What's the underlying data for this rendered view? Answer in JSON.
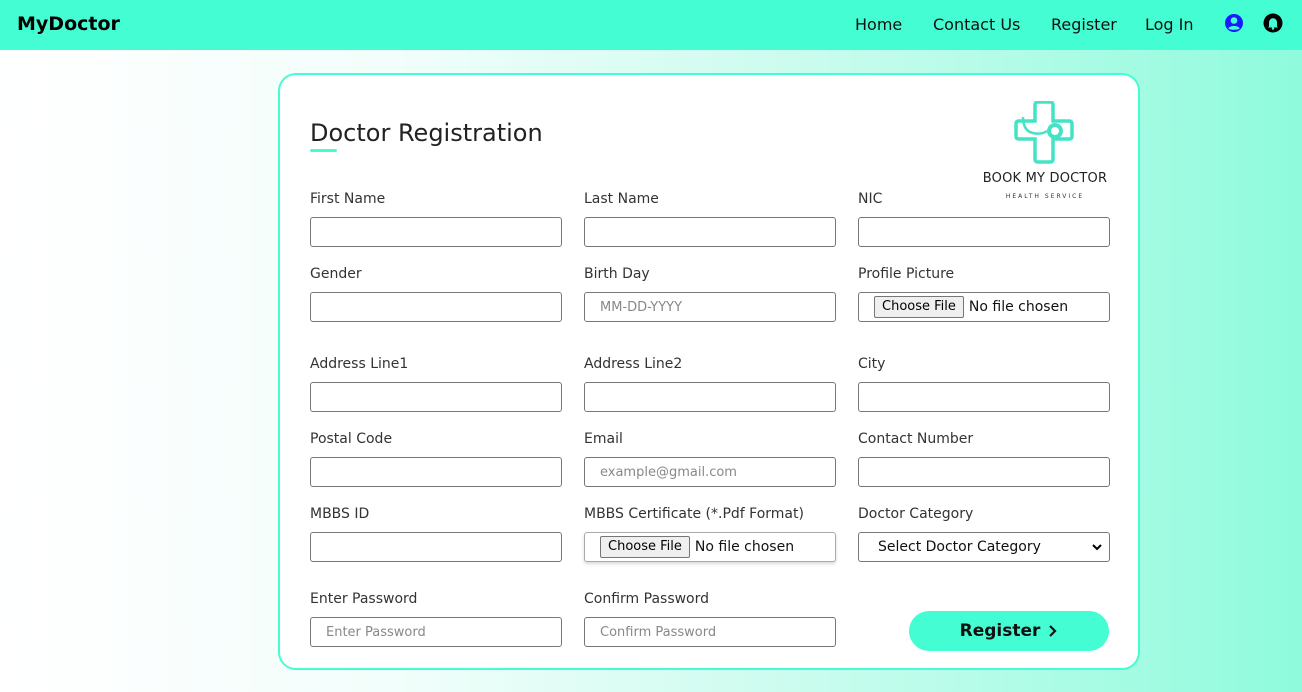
{
  "nav": {
    "brand": "MyDoctor",
    "links": [
      "Home",
      "Contact Us",
      "Register",
      "Log In"
    ],
    "icons": [
      "user-circle-icon",
      "bell-icon"
    ]
  },
  "form": {
    "title": "Doctor Registration",
    "logo": {
      "text": "BOOK MY DOCTOR",
      "subtext": "HEALTH SERVICE"
    },
    "labels": {
      "first_name": "First Name",
      "last_name": "Last Name",
      "nic": "NIC",
      "gender": "Gender",
      "birth_day": "Birth Day",
      "profile_picture": "Profile Picture",
      "address1": "Address Line1",
      "address2": "Address Line2",
      "city": "City",
      "postal_code": "Postal Code",
      "email": "Email",
      "contact_number": "Contact Number",
      "mbbs_id": "MBBS ID",
      "mbbs_cert": "MBBS Certificate (*.Pdf Format)",
      "doctor_category": "Doctor Category",
      "enter_password": "Enter Password",
      "confirm_password": "Confirm Password"
    },
    "placeholders": {
      "birth_day": "MM-DD-YYYY",
      "email": "example@gmail.com",
      "enter_password": "Enter Password",
      "confirm_password": "Confirm Password"
    },
    "file": {
      "button": "Choose File",
      "status": "No file chosen"
    },
    "category_select": "Select Doctor Category",
    "submit": "Register"
  },
  "colors": {
    "accent": "#45fdd2",
    "card_border": "#45fdd2",
    "icon_user": "#1a1aff"
  }
}
